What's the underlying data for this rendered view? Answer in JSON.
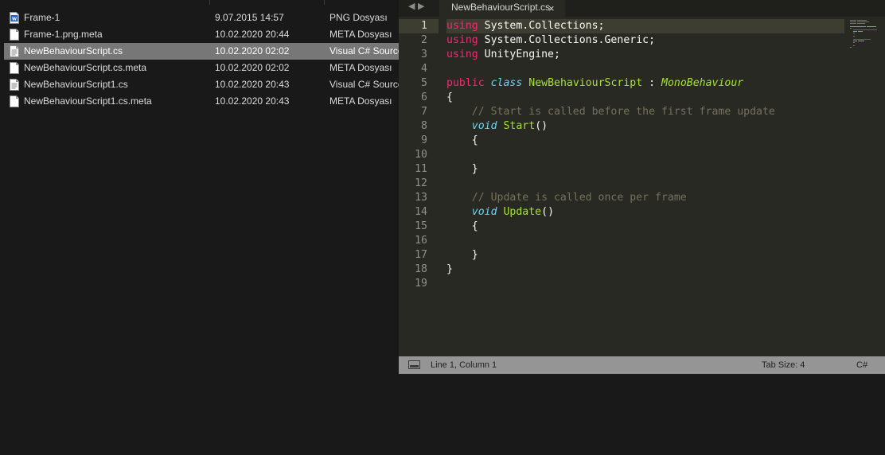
{
  "explorer": {
    "files": [
      {
        "name": "Frame-1",
        "date": "9.07.2015 14:57",
        "type": "PNG Dosyası",
        "icon": "png-image-icon",
        "selected": false
      },
      {
        "name": "Frame-1.png.meta",
        "date": "10.02.2020 20:44",
        "type": "META Dosyası",
        "icon": "file-icon",
        "selected": false
      },
      {
        "name": "NewBehaviourScript.cs",
        "date": "10.02.2020 02:02",
        "type": "Visual C# Source",
        "icon": "text-file-icon",
        "selected": true
      },
      {
        "name": "NewBehaviourScript.cs.meta",
        "date": "10.02.2020 02:02",
        "type": "META Dosyası",
        "icon": "file-icon",
        "selected": false
      },
      {
        "name": "NewBehaviourScript1.cs",
        "date": "10.02.2020 20:43",
        "type": "Visual C# Source",
        "icon": "text-file-icon",
        "selected": false
      },
      {
        "name": "NewBehaviourScript1.cs.meta",
        "date": "10.02.2020 20:43",
        "type": "META Dosyası",
        "icon": "file-icon",
        "selected": false
      }
    ]
  },
  "editor": {
    "nav_back": "◀",
    "nav_forward": "▶",
    "tab_label": "NewBehaviourScript.cs",
    "tab_close": "×",
    "active_line": 1,
    "line_numbers": [
      "1",
      "2",
      "3",
      "4",
      "5",
      "6",
      "7",
      "8",
      "9",
      "10",
      "11",
      "12",
      "13",
      "14",
      "15",
      "16",
      "17",
      "18",
      "19"
    ],
    "code_lines": [
      [
        {
          "t": "using",
          "c": "kw-pink"
        },
        {
          "t": " System.Collections;",
          "c": ""
        }
      ],
      [
        {
          "t": "using",
          "c": "kw-pink"
        },
        {
          "t": " System.Collections.Generic;",
          "c": ""
        }
      ],
      [
        {
          "t": "using",
          "c": "kw-pink"
        },
        {
          "t": " UnityEngine;",
          "c": ""
        }
      ],
      [],
      [
        {
          "t": "public",
          "c": "kw-pink"
        },
        {
          "t": " ",
          "c": ""
        },
        {
          "t": "class",
          "c": "kw-blue"
        },
        {
          "t": " ",
          "c": ""
        },
        {
          "t": "NewBehaviourScript",
          "c": "cls-green"
        },
        {
          "t": " : ",
          "c": ""
        },
        {
          "t": "MonoBehaviour",
          "c": "inh"
        }
      ],
      [
        {
          "t": "{",
          "c": ""
        }
      ],
      [
        {
          "t": "    // Start is called before the first frame update",
          "c": "cmt"
        }
      ],
      [
        {
          "t": "    ",
          "c": ""
        },
        {
          "t": "void",
          "c": "kw-type"
        },
        {
          "t": " ",
          "c": ""
        },
        {
          "t": "Start",
          "c": "fn"
        },
        {
          "t": "()",
          "c": ""
        }
      ],
      [
        {
          "t": "    {",
          "c": ""
        }
      ],
      [],
      [
        {
          "t": "    }",
          "c": ""
        }
      ],
      [],
      [
        {
          "t": "    // Update is called once per frame",
          "c": "cmt"
        }
      ],
      [
        {
          "t": "    ",
          "c": ""
        },
        {
          "t": "void",
          "c": "kw-type"
        },
        {
          "t": " ",
          "c": ""
        },
        {
          "t": "Update",
          "c": "fn"
        },
        {
          "t": "()",
          "c": ""
        }
      ],
      [
        {
          "t": "    {",
          "c": ""
        }
      ],
      [],
      [
        {
          "t": "    }",
          "c": ""
        }
      ],
      [
        {
          "t": "}",
          "c": ""
        }
      ],
      []
    ]
  },
  "statusbar": {
    "position": "Line 1, Column 1",
    "tab_size": "Tab Size: 4",
    "syntax": "C#"
  }
}
